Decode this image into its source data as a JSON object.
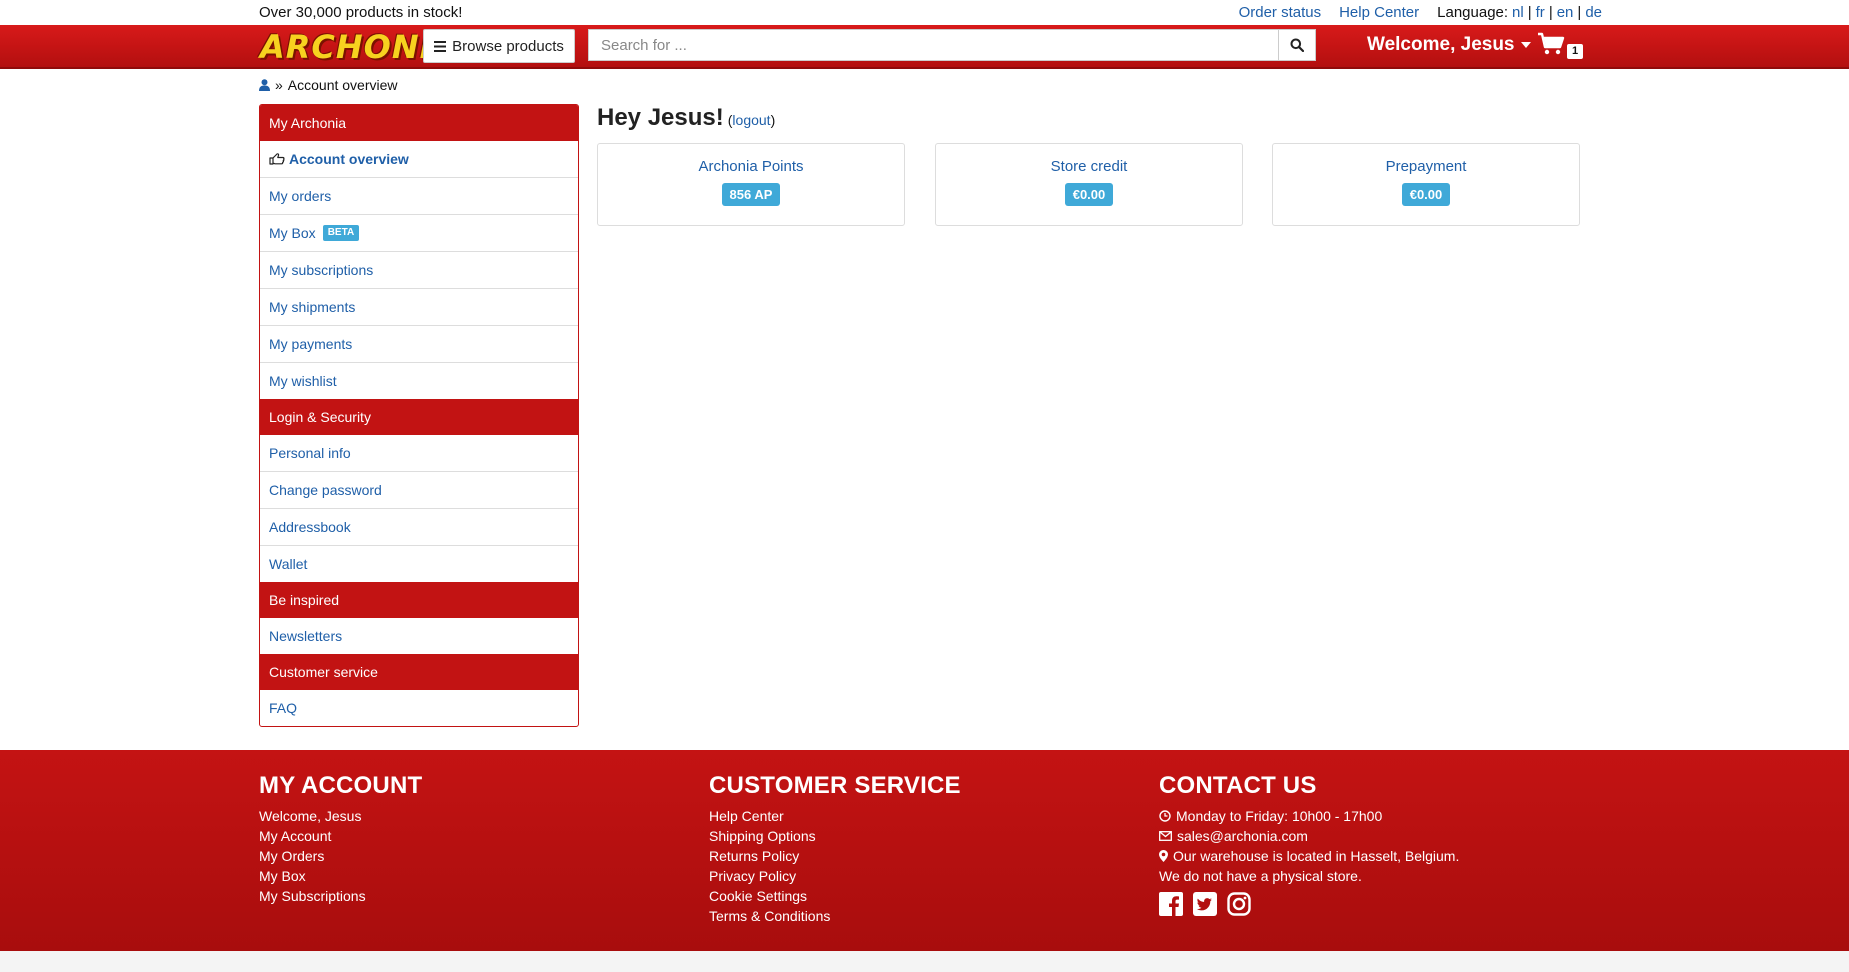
{
  "topbar": {
    "stock_text": "Over 30,000 products in stock!",
    "order_status": "Order status",
    "help_center": "Help Center",
    "language_label": "Language:",
    "languages": [
      "nl",
      "fr",
      "en",
      "de"
    ]
  },
  "header": {
    "logo_text": "ARCHONIA",
    "browse_label": "Browse products",
    "search_placeholder": "Search for ...",
    "welcome": "Welcome, Jesus",
    "cart_count": "1"
  },
  "breadcrumb": {
    "separator": "»",
    "current": "Account overview"
  },
  "sidebar": {
    "sections": [
      {
        "title": "My Archonia",
        "items": [
          {
            "label": "Account overview",
            "active": true
          },
          {
            "label": "My orders"
          },
          {
            "label": "My Box",
            "badge": "BETA"
          },
          {
            "label": "My subscriptions"
          },
          {
            "label": "My shipments"
          },
          {
            "label": "My payments"
          },
          {
            "label": "My wishlist"
          }
        ]
      },
      {
        "title": "Login & Security",
        "items": [
          {
            "label": "Personal info"
          },
          {
            "label": "Change password"
          },
          {
            "label": "Addressbook"
          },
          {
            "label": "Wallet"
          }
        ]
      },
      {
        "title": "Be inspired",
        "items": [
          {
            "label": "Newsletters"
          }
        ]
      },
      {
        "title": "Customer service",
        "items": [
          {
            "label": "FAQ"
          }
        ]
      }
    ]
  },
  "main": {
    "greeting": "Hey Jesus!",
    "logout_open": "(",
    "logout_label": "logout",
    "logout_close": ")",
    "cards": [
      {
        "title": "Archonia Points",
        "value": "856 AP"
      },
      {
        "title": "Store credit",
        "value": "€0.00"
      },
      {
        "title": "Prepayment",
        "value": "€0.00"
      }
    ]
  },
  "footer": {
    "my_account": {
      "title": "MY ACCOUNT",
      "links": [
        "Welcome, Jesus",
        "My Account",
        "My Orders",
        "My Box",
        "My Subscriptions"
      ]
    },
    "customer_service": {
      "title": "CUSTOMER SERVICE",
      "links": [
        "Help Center",
        "Shipping Options",
        "Returns Policy",
        "Privacy Policy",
        "Cookie Settings",
        "Terms & Conditions"
      ]
    },
    "contact": {
      "title": "CONTACT US",
      "hours": "Monday to Friday: 10h00 - 17h00",
      "email": "sales@archonia.com",
      "warehouse": "Our warehouse is located in Hasselt, Belgium.",
      "no_store": "We do not have a physical store.",
      "social_icons": [
        "facebook-icon",
        "twitter-icon",
        "instagram-icon"
      ]
    }
  },
  "colors": {
    "brand_red": "#c21313",
    "link_blue": "#1f5fa8",
    "badge_blue": "#3fa9d8",
    "logo_yellow": "#f7d21f"
  }
}
